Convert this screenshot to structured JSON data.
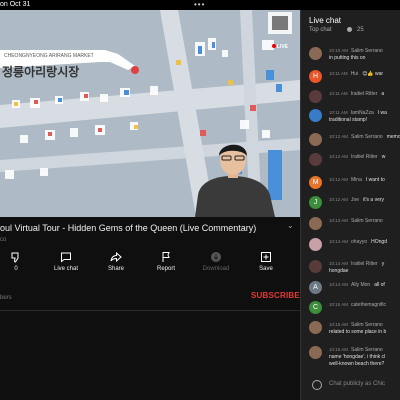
{
  "status_bar": {
    "date": "on Oct 31",
    "dots": "•••"
  },
  "video": {
    "sign_top": "CHEONGNYEONG ARIRANG MARKET",
    "sign_korean": "정릉아리랑시장",
    "live_label": "LIVE"
  },
  "title": "oul Virtual Tour - Hidden Gems of the Queen (Live Commentary)",
  "meta": "co",
  "actions": {
    "like_count": "0",
    "live_chat": "Live chat",
    "share": "Share",
    "report": "Report",
    "download": "Download",
    "save": "Save"
  },
  "subscribers_label": "bers",
  "subscribe_label": "SUBSCRIBE",
  "chat": {
    "heading": "Live chat",
    "mode": "Top chat",
    "viewer_count": "25",
    "input_placeholder": "Chat publicly as Chic",
    "messages": [
      {
        "time": "10:10 AM",
        "name": "Salim Serrano",
        "text": "in putting this on",
        "avatar_letter": "",
        "avatar_color": "#8a6a55"
      },
      {
        "time": "10:11 AM",
        "name": "Hui",
        "text": "😊👍 war",
        "avatar_letter": "H",
        "avatar_color": "#e8562a"
      },
      {
        "time": "10:11 AM",
        "name": "Iraitiel Ritter",
        "text": "a",
        "avatar_letter": "",
        "avatar_color": "#5a3b3b"
      },
      {
        "time": "10:11 AM",
        "name": "IamNaZza",
        "text": "I wa",
        "text2": "traditional stamp!",
        "avatar_letter": "",
        "avatar_color": "#3a7bc8"
      },
      {
        "time": "10:12 AM",
        "name": "Salim Serrano",
        "text": "memories..",
        "avatar_letter": "",
        "avatar_color": "#8a6a55"
      },
      {
        "time": "10:12 AM",
        "name": "Iraitiel Ritter",
        "text": "w",
        "avatar_letter": "",
        "avatar_color": "#5a3b3b"
      },
      {
        "time": "10:12 AM",
        "name": "Mina",
        "text": "I want to",
        "avatar_letter": "M",
        "avatar_color": "#e8752a"
      },
      {
        "time": "10:12 AM",
        "name": "Joe",
        "text": "it's a very",
        "avatar_letter": "J",
        "avatar_color": "#3c8d3c"
      },
      {
        "time": "10:13 AM",
        "name": "Salim Serrano",
        "text": "",
        "avatar_letter": "",
        "avatar_color": "#8a6a55"
      },
      {
        "time": "10:14 AM",
        "name": "ohayyo",
        "text": "HOngd",
        "avatar_letter": "",
        "avatar_color": "#c9a0a8"
      },
      {
        "time": "10:14 AM",
        "name": "Iraitiel Ritter",
        "text": "y",
        "text2": "hongdae",
        "avatar_letter": "",
        "avatar_color": "#5a3b3b"
      },
      {
        "time": "10:14 AM",
        "name": "Ally Mon",
        "text": "all of",
        "avatar_letter": "A",
        "avatar_color": "#6d7a86"
      },
      {
        "time": "10:15 AM",
        "name": "catethemagnific",
        "text": "",
        "avatar_letter": "C",
        "avatar_color": "#3c8d3c"
      },
      {
        "time": "10:15 AM",
        "name": "Salim Serrano",
        "text": "related to some place in b",
        "avatar_letter": "",
        "avatar_color": "#8a6a55"
      },
      {
        "time": "10:16 AM",
        "name": "Salim Serrano",
        "text": "name 'hongdae', i think cl",
        "text2": "well-known beach there?",
        "avatar_letter": "",
        "avatar_color": "#8a6a55"
      }
    ]
  }
}
